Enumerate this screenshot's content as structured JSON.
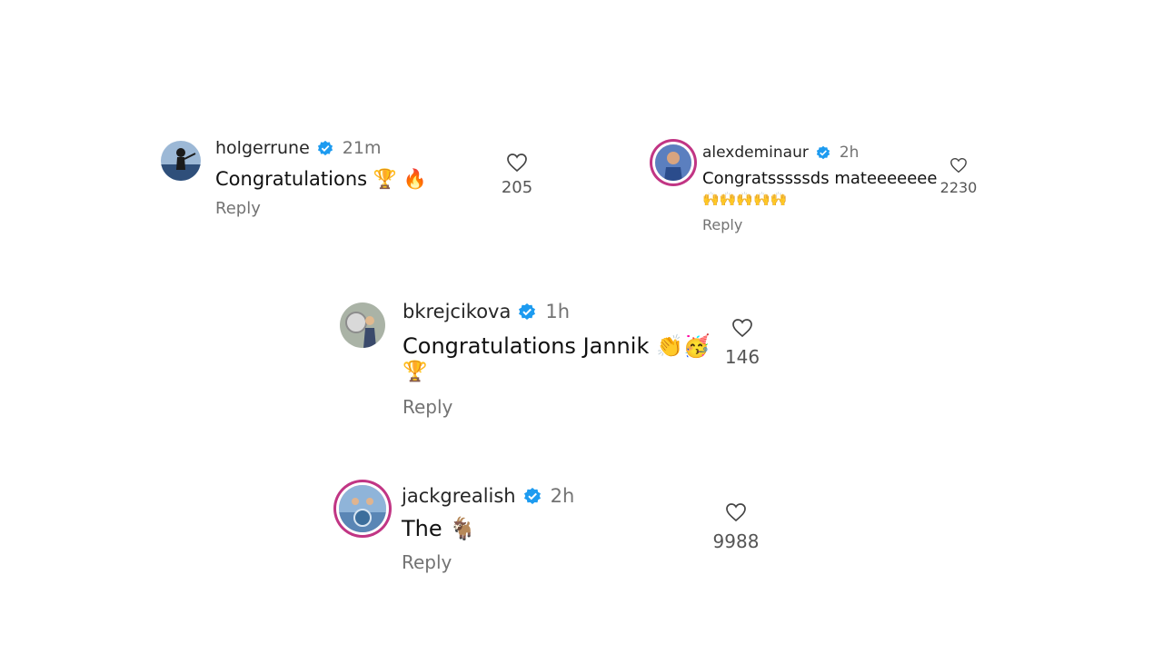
{
  "comments": [
    {
      "username": "holgerrune",
      "time": "21m",
      "text": "Congratulations 🏆 🔥",
      "reply_label": "Reply",
      "likes": "205",
      "verified_icon": "verified-badge-icon"
    },
    {
      "username": "alexdeminaur",
      "time": "2h",
      "text": "Congratsssssds mateeeeeee",
      "text_line2": "🙌🙌🙌🙌🙌",
      "reply_label": "Reply",
      "likes": "2230",
      "verified_icon": "verified-badge-icon"
    },
    {
      "username": "bkrejcikova",
      "time": "1h",
      "text": "Congratulations Jannik 👏🥳",
      "text_line2": "🏆",
      "reply_label": "Reply",
      "likes": "146",
      "verified_icon": "verified-badge-icon"
    },
    {
      "username": "jackgrealish",
      "time": "2h",
      "text": "The 🐐",
      "reply_label": "Reply",
      "likes": "9988",
      "verified_icon": "verified-badge-icon"
    }
  ],
  "colors": {
    "verified": "#1d9bf0",
    "muted": "#737373",
    "story_ring": "#c13584"
  }
}
